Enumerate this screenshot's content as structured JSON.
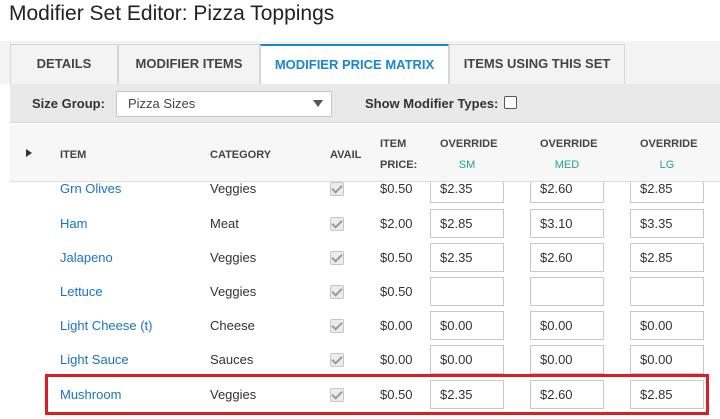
{
  "title": "Modifier Set Editor: Pizza Toppings",
  "tabs": [
    {
      "label": "DETAILS"
    },
    {
      "label": "MODIFIER ITEMS"
    },
    {
      "label": "MODIFIER PRICE MATRIX",
      "active": true
    },
    {
      "label": "ITEMS USING THIS SET"
    }
  ],
  "toolbar": {
    "size_group_label": "Size Group:",
    "size_group_value": "Pizza Sizes",
    "show_modifier_types_label": "Show Modifier Types:",
    "show_modifier_types_checked": false
  },
  "columns": {
    "item": "ITEM",
    "category": "CATEGORY",
    "avail": "AVAIL",
    "item_price_1": "ITEM",
    "item_price_2": "PRICE:",
    "override_sm": "OVERRIDE",
    "sm": "SM",
    "override_med": "OVERRIDE",
    "med": "MED",
    "override_lg": "OVERRIDE",
    "lg": "LG"
  },
  "rows": [
    {
      "item": "Grn Olives",
      "category": "Veggies",
      "avail": true,
      "price": "$0.50",
      "sm": "$2.35",
      "med": "$2.60",
      "lg": "$2.85"
    },
    {
      "item": "Ham",
      "category": "Meat",
      "avail": true,
      "price": "$2.00",
      "sm": "$2.85",
      "med": "$3.10",
      "lg": "$3.35"
    },
    {
      "item": "Jalapeno",
      "category": "Veggies",
      "avail": true,
      "price": "$0.50",
      "sm": "$2.35",
      "med": "$2.60",
      "lg": "$2.85"
    },
    {
      "item": "Lettuce",
      "category": "Veggies",
      "avail": true,
      "price": "$0.50",
      "sm": "",
      "med": "",
      "lg": ""
    },
    {
      "item": "Light Cheese (t)",
      "category": "Cheese",
      "avail": true,
      "price": "$0.00",
      "sm": "$0.00",
      "med": "$0.00",
      "lg": "$0.00"
    },
    {
      "item": "Light Sauce",
      "category": "Sauces",
      "avail": true,
      "price": "$0.00",
      "sm": "$0.00",
      "med": "$0.00",
      "lg": "$0.00"
    },
    {
      "item": "Mushroom",
      "category": "Veggies",
      "avail": true,
      "price": "$0.50",
      "sm": "$2.35",
      "med": "$2.60",
      "lg": "$2.85"
    }
  ],
  "colors": {
    "accent": "#1a86d0",
    "highlight": "#e01b24",
    "size_label": "#1fa58a"
  }
}
